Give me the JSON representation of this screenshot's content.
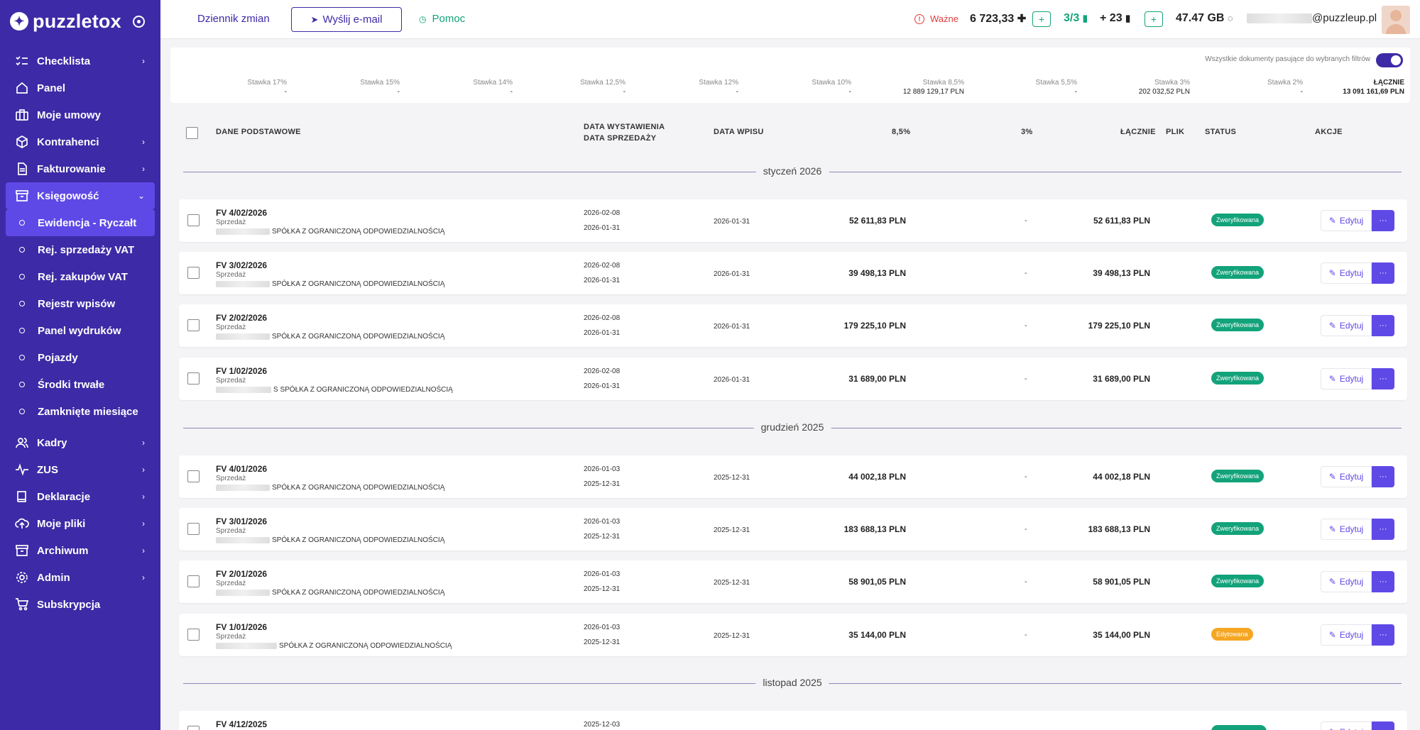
{
  "app": {
    "logo_text": "puzzletox"
  },
  "colors": {
    "brand": "#3d2aa6",
    "active": "#5f49e6",
    "green": "#13a37a",
    "orange": "#f5a623",
    "important": "#e23b3b"
  },
  "sidebar": {
    "items": [
      {
        "label": "Checklista",
        "icon": "checklist-icon",
        "has_children": true
      },
      {
        "label": "Panel",
        "icon": "home-icon",
        "has_children": false
      },
      {
        "label": "Moje umowy",
        "icon": "briefcase-icon",
        "has_children": false
      },
      {
        "label": "Kontrahenci",
        "icon": "box-icon",
        "has_children": true
      },
      {
        "label": "Fakturowanie",
        "icon": "document-icon",
        "has_children": true
      },
      {
        "label": "Księgowość",
        "icon": "archive-icon",
        "has_children": true,
        "expanded": true
      },
      {
        "label": "Kadry",
        "icon": "users-icon",
        "has_children": true
      },
      {
        "label": "ZUS",
        "icon": "pulse-icon",
        "has_children": true
      },
      {
        "label": "Deklaracje",
        "icon": "book-icon",
        "has_children": true
      },
      {
        "label": "Moje pliki",
        "icon": "cloud-upload-icon",
        "has_children": true
      },
      {
        "label": "Archiwum",
        "icon": "archive-box-icon",
        "has_children": true
      },
      {
        "label": "Admin",
        "icon": "gear-icon",
        "has_children": true
      },
      {
        "label": "Subskrypcja",
        "icon": "cart-icon",
        "has_children": false
      }
    ],
    "subitems": [
      {
        "label": "Ewidencja - Ryczałt",
        "active": true
      },
      {
        "label": "Rej. sprzedaży VAT"
      },
      {
        "label": "Rej. zakupów VAT"
      },
      {
        "label": "Rejestr wpisów"
      },
      {
        "label": "Panel wydruków"
      },
      {
        "label": "Pojazdy"
      },
      {
        "label": "Środki trwałe"
      },
      {
        "label": "Zamknięte miesiące"
      }
    ]
  },
  "topbar": {
    "changelog": "Dziennik zmian",
    "send_email": "Wyślij e-mail",
    "help": "Pomoc",
    "important": "Ważne",
    "amount": "6 723,33",
    "docs_ratio": "3/3",
    "plus_count": "+ 23",
    "plus_symbol": "+",
    "storage": "47.47 GB",
    "email_suffix": "@puzzleup.pl"
  },
  "summary": {
    "note": "Wszystkie dokumenty pasujące do wybranych filtrów",
    "rates": [
      {
        "label": "Stawka 17%",
        "value": "-"
      },
      {
        "label": "Stawka 15%",
        "value": "-"
      },
      {
        "label": "Stawka 14%",
        "value": "-"
      },
      {
        "label": "Stawka 12,5%",
        "value": "-"
      },
      {
        "label": "Stawka 12%",
        "value": "-"
      },
      {
        "label": "Stawka 10%",
        "value": "-"
      },
      {
        "label": "Stawka 8,5%",
        "value": "12 889 129,17 PLN"
      },
      {
        "label": "Stawka 5,5%",
        "value": "-"
      },
      {
        "label": "Stawka 3%",
        "value": "202 032,52 PLN"
      },
      {
        "label": "Stawka 2%",
        "value": "-"
      }
    ],
    "total_label": "ŁĄCZNIE",
    "total_value": "13 091 161,69 PLN"
  },
  "table": {
    "headers": {
      "basic": "DANE PODSTAWOWE",
      "issue_date": "DATA WYSTAWIENIA",
      "sale_date": "DATA SPRZEDAŻY",
      "entry_date": "DATA WPISU",
      "rate85": "8,5%",
      "rate3": "3%",
      "total": "ŁĄCZNIE",
      "file": "PLIK",
      "status": "STATUS",
      "actions": "AKCJE"
    },
    "edit_label": "Edytuj",
    "more_label": "···",
    "groups": [
      {
        "label": "styczeń 2026"
      },
      {
        "label": "grudzień 2025"
      },
      {
        "label": "listopad 2025"
      }
    ],
    "rows": [
      {
        "number": "FV 4/02/2026",
        "type": "Sprzedaż",
        "company": "SPÓŁKA Z OGRANICZONĄ ODPOWIEDZIALNOŚCIĄ",
        "issue": "2026-02-08",
        "sale": "2026-01-31",
        "entry": "2026-01-31",
        "v85": "52 611,83 PLN",
        "v3": "-",
        "total": "52 611,83 PLN",
        "status": "Zweryfikowana",
        "status_color": "#13a37a"
      },
      {
        "number": "FV 3/02/2026",
        "type": "Sprzedaż",
        "company": "SPÓŁKA Z OGRANICZONĄ ODPOWIEDZIALNOŚCIĄ",
        "issue": "2026-02-08",
        "sale": "2026-01-31",
        "entry": "2026-01-31",
        "v85": "39 498,13 PLN",
        "v3": "-",
        "total": "39 498,13 PLN",
        "status": "Zweryfikowana",
        "status_color": "#13a37a"
      },
      {
        "number": "FV 2/02/2026",
        "type": "Sprzedaż",
        "company": "SPÓŁKA Z OGRANICZONĄ ODPOWIEDZIALNOŚCIĄ",
        "issue": "2026-02-08",
        "sale": "2026-01-31",
        "entry": "2026-01-31",
        "v85": "179 225,10 PLN",
        "v3": "-",
        "total": "179 225,10 PLN",
        "status": "Zweryfikowana",
        "status_color": "#13a37a"
      },
      {
        "number": "FV 1/02/2026",
        "type": "Sprzedaż",
        "company": "S SPÓŁKA Z OGRANICZONĄ ODPOWIEDZIALNOŚCIĄ",
        "issue": "2026-02-08",
        "sale": "2026-01-31",
        "entry": "2026-01-31",
        "v85": "31 689,00 PLN",
        "v3": "-",
        "total": "31 689,00 PLN",
        "status": "Zweryfikowana",
        "status_color": "#13a37a"
      },
      {
        "number": "FV 4/01/2026",
        "type": "Sprzedaż",
        "company": "SPÓŁKA Z OGRANICZONĄ ODPOWIEDZIALNOŚCIĄ",
        "issue": "2026-01-03",
        "sale": "2025-12-31",
        "entry": "2025-12-31",
        "v85": "44 002,18 PLN",
        "v3": "-",
        "total": "44 002,18 PLN",
        "status": "Zweryfikowana",
        "status_color": "#13a37a"
      },
      {
        "number": "FV 3/01/2026",
        "type": "Sprzedaż",
        "company": "SPÓŁKA Z OGRANICZONĄ ODPOWIEDZIALNOŚCIĄ",
        "issue": "2026-01-03",
        "sale": "2025-12-31",
        "entry": "2025-12-31",
        "v85": "183 688,13 PLN",
        "v3": "-",
        "total": "183 688,13 PLN",
        "status": "Zweryfikowana",
        "status_color": "#13a37a"
      },
      {
        "number": "FV 2/01/2026",
        "type": "Sprzedaż",
        "company": "SPÓŁKA Z OGRANICZONĄ ODPOWIEDZIALNOŚCIĄ",
        "issue": "2026-01-03",
        "sale": "2025-12-31",
        "entry": "2025-12-31",
        "v85": "58 901,05 PLN",
        "v3": "-",
        "total": "58 901,05 PLN",
        "status": "Zweryfikowana",
        "status_color": "#13a37a"
      },
      {
        "number": "FV 1/01/2026",
        "type": "Sprzedaż",
        "company": "SPÓŁKA Z OGRANICZONĄ ODPOWIEDZIALNOŚCIĄ",
        "issue": "2026-01-03",
        "sale": "2025-12-31",
        "entry": "2025-12-31",
        "v85": "35 144,00 PLN",
        "v3": "-",
        "total": "35 144,00 PLN",
        "status": "Edytowana",
        "status_color": "#f5a623"
      },
      {
        "number": "FV 4/12/2025",
        "type": "",
        "company": "",
        "issue": "2025-12-03",
        "sale": "",
        "entry": "",
        "v85": "",
        "v3": "",
        "total": "",
        "status": "",
        "status_color": "#13a37a"
      }
    ]
  }
}
